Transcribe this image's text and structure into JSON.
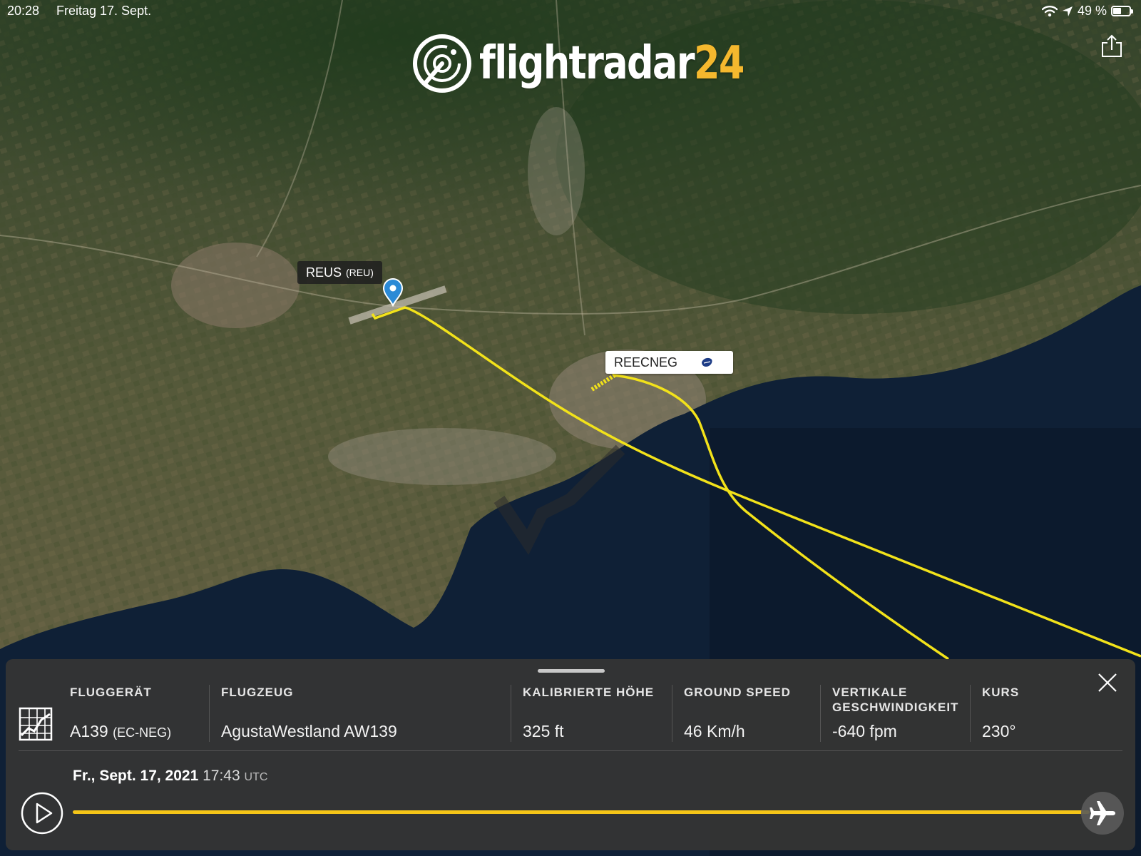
{
  "status_bar": {
    "time": "20:28",
    "date": "Freitag 17. Sept.",
    "battery_text": "49 %",
    "battery_level": 0.49
  },
  "logo": {
    "text_main": "flightradar",
    "text_num": "24",
    "accent_color": "#f5b82e"
  },
  "map": {
    "airport_label": {
      "name": "REUS",
      "code": "(REU)"
    },
    "flight_label": {
      "callsign": "REECNEG",
      "icon": "airline-logo-icon"
    },
    "track_color": "#f2e21a",
    "sea_color": "#0f2036",
    "land_color": "#44502f"
  },
  "panel": {
    "columns": [
      {
        "title": "FLUGGERÄT",
        "value": "A139",
        "value_small": "(EC-NEG)"
      },
      {
        "title": "FLUGZEUG",
        "value": "AgustaWestland AW139"
      },
      {
        "title": "KALIBRIERTE HÖHE",
        "value": "325 ft"
      },
      {
        "title": "GROUND SPEED",
        "value": "46 Km/h"
      },
      {
        "title_line1": "VERTIKALE",
        "title_line2": "GESCHWINDIGKEIT",
        "value": "-640 fpm"
      },
      {
        "title": "KURS",
        "value": "230°"
      }
    ],
    "date": "Fr., Sept. 17, 2021",
    "time": "17:43",
    "tz": "UTC",
    "timeline_progress": 1.0,
    "timeline_color": "#f5c518"
  }
}
